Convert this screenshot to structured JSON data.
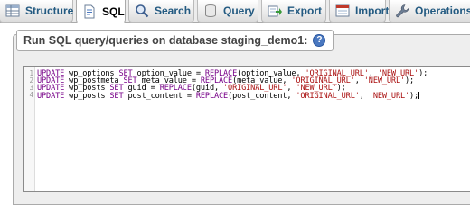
{
  "tabs": [
    {
      "label": "Structure",
      "icon": "structure-icon"
    },
    {
      "label": "SQL",
      "icon": "sql-icon",
      "active": true
    },
    {
      "label": "Search",
      "icon": "search-icon"
    },
    {
      "label": "Query",
      "icon": "query-icon"
    },
    {
      "label": "Export",
      "icon": "export-icon"
    },
    {
      "label": "Import",
      "icon": "import-icon"
    },
    {
      "label": "Operations",
      "icon": "wrench-icon"
    }
  ],
  "sql_panel": {
    "legend": "Run SQL query/queries on database staging_demo1:",
    "help_glyph": "?"
  },
  "editor": {
    "line_numbers": [
      "1",
      "2",
      "3",
      "4"
    ],
    "lines": [
      {
        "t1": "UPDATE",
        "t2": " wp_options ",
        "t3": "SET",
        "t4": " option_value = ",
        "t5": "REPLACE",
        "t6": "(option_value, ",
        "t7": "'ORIGINAL_URL'",
        "t8": ", ",
        "t9": "'NEW_URL'",
        "t10": ");"
      },
      {
        "t1": "UPDATE",
        "t2": " wp_postmeta ",
        "t3": "SET",
        "t4": " meta_value = ",
        "t5": "REPLACE",
        "t6": "(meta_value, ",
        "t7": "'ORIGINAL_URL'",
        "t8": ", ",
        "t9": "'NEW_URL'",
        "t10": ");"
      },
      {
        "t1": "UPDATE",
        "t2": " wp_posts ",
        "t3": "SET",
        "t4": " guid = ",
        "t5": "REPLACE",
        "t6": "(guid, ",
        "t7": "'ORIGINAL_URL'",
        "t8": ", ",
        "t9": "'NEW_URL'",
        "t10": ");"
      },
      {
        "t1": "UPDATE",
        "t2": " wp_posts ",
        "t3": "SET",
        "t4": " post_content = ",
        "t5": "REPLACE",
        "t6": "(post_content, ",
        "t7": "'ORIGINAL_URL'",
        "t8": ", ",
        "t9": "'NEW_URL'",
        "t10": ");"
      }
    ]
  },
  "colors": {
    "tab_text": "#235a81",
    "keyword": "#770088",
    "string": "#aa1111",
    "help_icon": "#4a78c0"
  }
}
